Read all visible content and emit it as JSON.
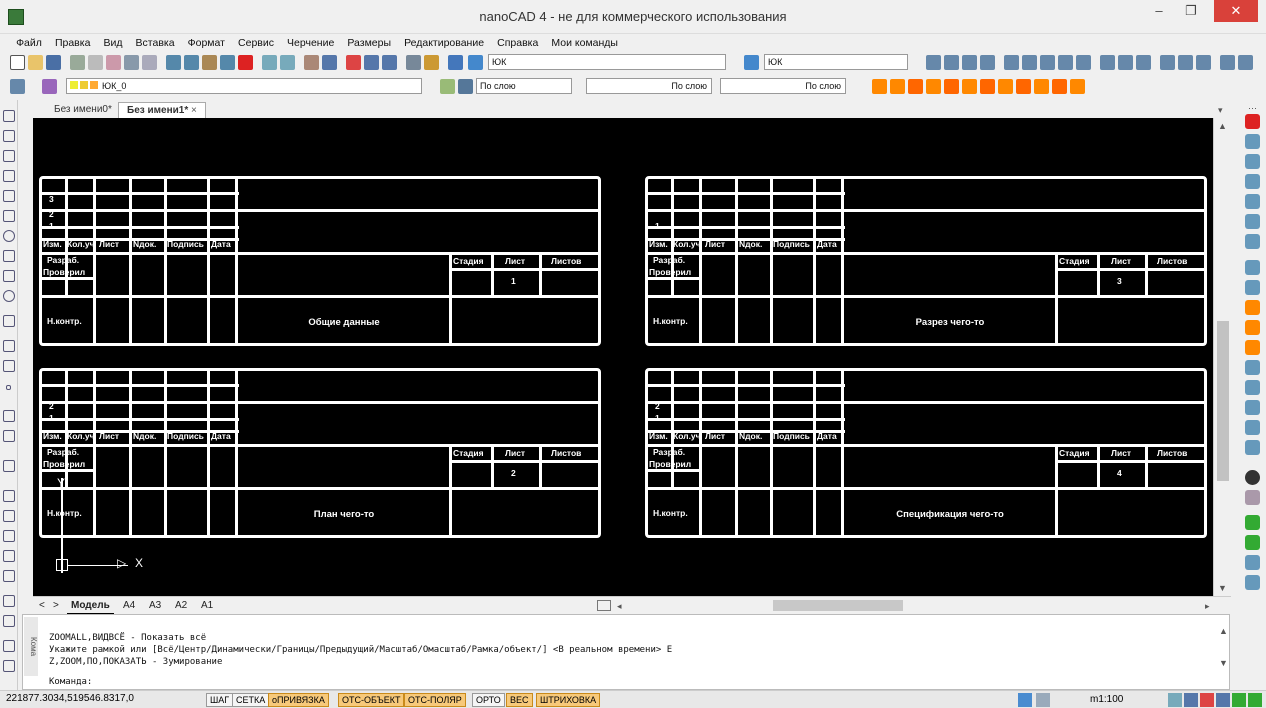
{
  "window": {
    "title": "nanoCAD 4 - не для коммерческого использования",
    "minimize": "–",
    "maximize": "❐",
    "close": "✕"
  },
  "menu": [
    "Файл",
    "Правка",
    "Вид",
    "Вставка",
    "Формат",
    "Сервис",
    "Черчение",
    "Размеры",
    "Редактирование",
    "Справка",
    "Мои команды"
  ],
  "toolbar": {
    "style1": "ЮК",
    "style2": "ЮК",
    "layer": "ЮК_0",
    "color": "По слою",
    "linetype": "По слою",
    "lineweight": "По слою"
  },
  "doc_tabs": [
    "Без имени0*",
    "Без имени1*"
  ],
  "doc_tab_close": "×",
  "layout_tabs": [
    "Модель",
    "A4",
    "A3",
    "A2",
    "A1"
  ],
  "layout_nav": {
    "prev": "<",
    "next": ">"
  },
  "stamp_labels": {
    "izm": "Изм.",
    "kol": "Кол.уч",
    "list": "Лист",
    "ndok": "Nдок.",
    "podpis": "Подпись",
    "data": "Дата",
    "razrab": "Разраб.",
    "proveril": "Проверил",
    "nkontr": "Н.контр.",
    "stadia": "Стадия",
    "list2": "Лист",
    "listov": "Листов"
  },
  "frames": [
    {
      "rows": [
        "3",
        "2",
        "1"
      ],
      "sheet": "1",
      "title": "Общие данные"
    },
    {
      "rows": [
        "",
        "",
        "1"
      ],
      "sheet": "3",
      "title": "Разрез чего-то"
    },
    {
      "rows": [
        "",
        "2",
        "1"
      ],
      "sheet": "2",
      "title": "План чего-то"
    },
    {
      "rows": [
        "",
        "2",
        "1"
      ],
      "sheet": "4",
      "title": "Спецификация чего-то"
    }
  ],
  "ucs": {
    "x": "X",
    "y": "Y"
  },
  "command": {
    "lines": [
      "ZOOMALL,ВИДВСЁ - Показать всё",
      "Укажите рамкой или [Всё/Центр/Динамически/Границы/Предыдущий/Масштаб/Омасштаб/Рамка/объект/] <В реальном времени> E",
      "Z,ZOOM,ПО,ПОКАЗАТЬ - Зумирование"
    ],
    "prompt": "Команда:",
    "side_label": "Кома"
  },
  "status": {
    "coords": "221877.3034,519546.8317,0",
    "buttons": [
      {
        "label": "ШАГ",
        "on": false
      },
      {
        "label": "СЕТКА",
        "on": false
      },
      {
        "label": "оПРИВЯЗКА",
        "on": true
      },
      {
        "label": "ОТС-ОБЪЕКТ",
        "on": true
      },
      {
        "label": "ОТС-ПОЛЯР",
        "on": true
      },
      {
        "label": "ОРТО",
        "on": false
      },
      {
        "label": "ВЕС",
        "on": true
      },
      {
        "label": "ШТРИХОВКА",
        "on": true
      }
    ],
    "scale": "m1:100"
  }
}
